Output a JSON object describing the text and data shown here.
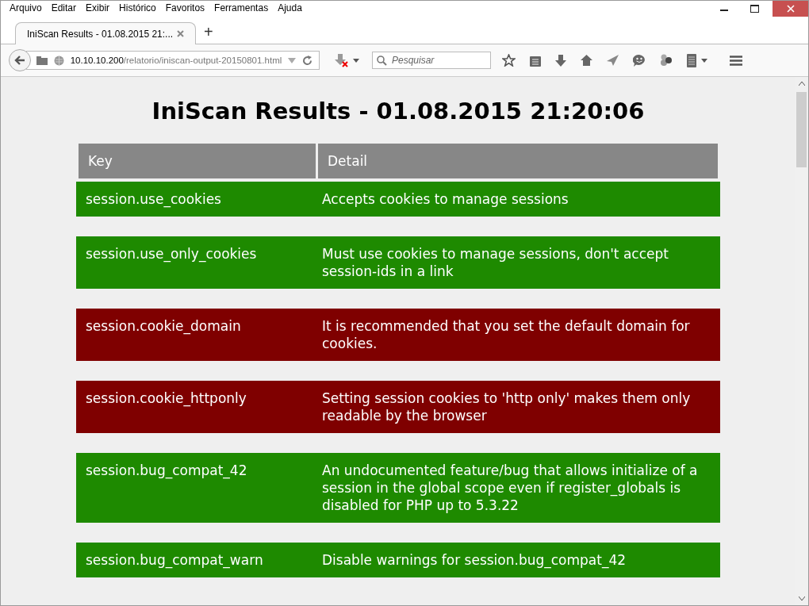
{
  "menu": [
    "Arquivo",
    "Editar",
    "Exibir",
    "Histórico",
    "Favoritos",
    "Ferramentas",
    "Ajuda"
  ],
  "tabs": [
    {
      "label": "IniScan Results - 01.08.2015 21:...",
      "selected": true
    }
  ],
  "new_tab": "+",
  "address": {
    "host": "10.10.10.200",
    "path": "/relatorio/iniscan-output-20150801.html"
  },
  "search": {
    "placeholder": "Pesquisar"
  },
  "page": {
    "title": "IniScan Results - 01.08.2015 21:20:06",
    "columns": [
      "Key",
      "Detail"
    ],
    "rows": [
      {
        "key": "session.use_cookies",
        "detail": "Accepts cookies to manage sessions",
        "color": "#1e8a00"
      },
      {
        "key": "session.use_only_cookies",
        "detail": "Must use cookies to manage sessions, don't accept session-ids in a link",
        "color": "#1e8a00"
      },
      {
        "key": "session.cookie_domain",
        "detail": "It is recommended that you set the default domain for cookies.",
        "color": "#7f0000"
      },
      {
        "key": "session.cookie_httponly",
        "detail": "Setting session cookies to 'http only' makes them only readable by the browser",
        "color": "#7f0000"
      },
      {
        "key": "session.bug_compat_42",
        "detail": "An undocumented feature/bug that allows initialize of a session in the global scope even if register_globals is disabled for PHP up to 5.3.22",
        "color": "#1e8a00"
      },
      {
        "key": "session.bug_compat_warn",
        "detail": "Disable warnings for session.bug_compat_42",
        "color": "#1e8a00"
      }
    ]
  }
}
